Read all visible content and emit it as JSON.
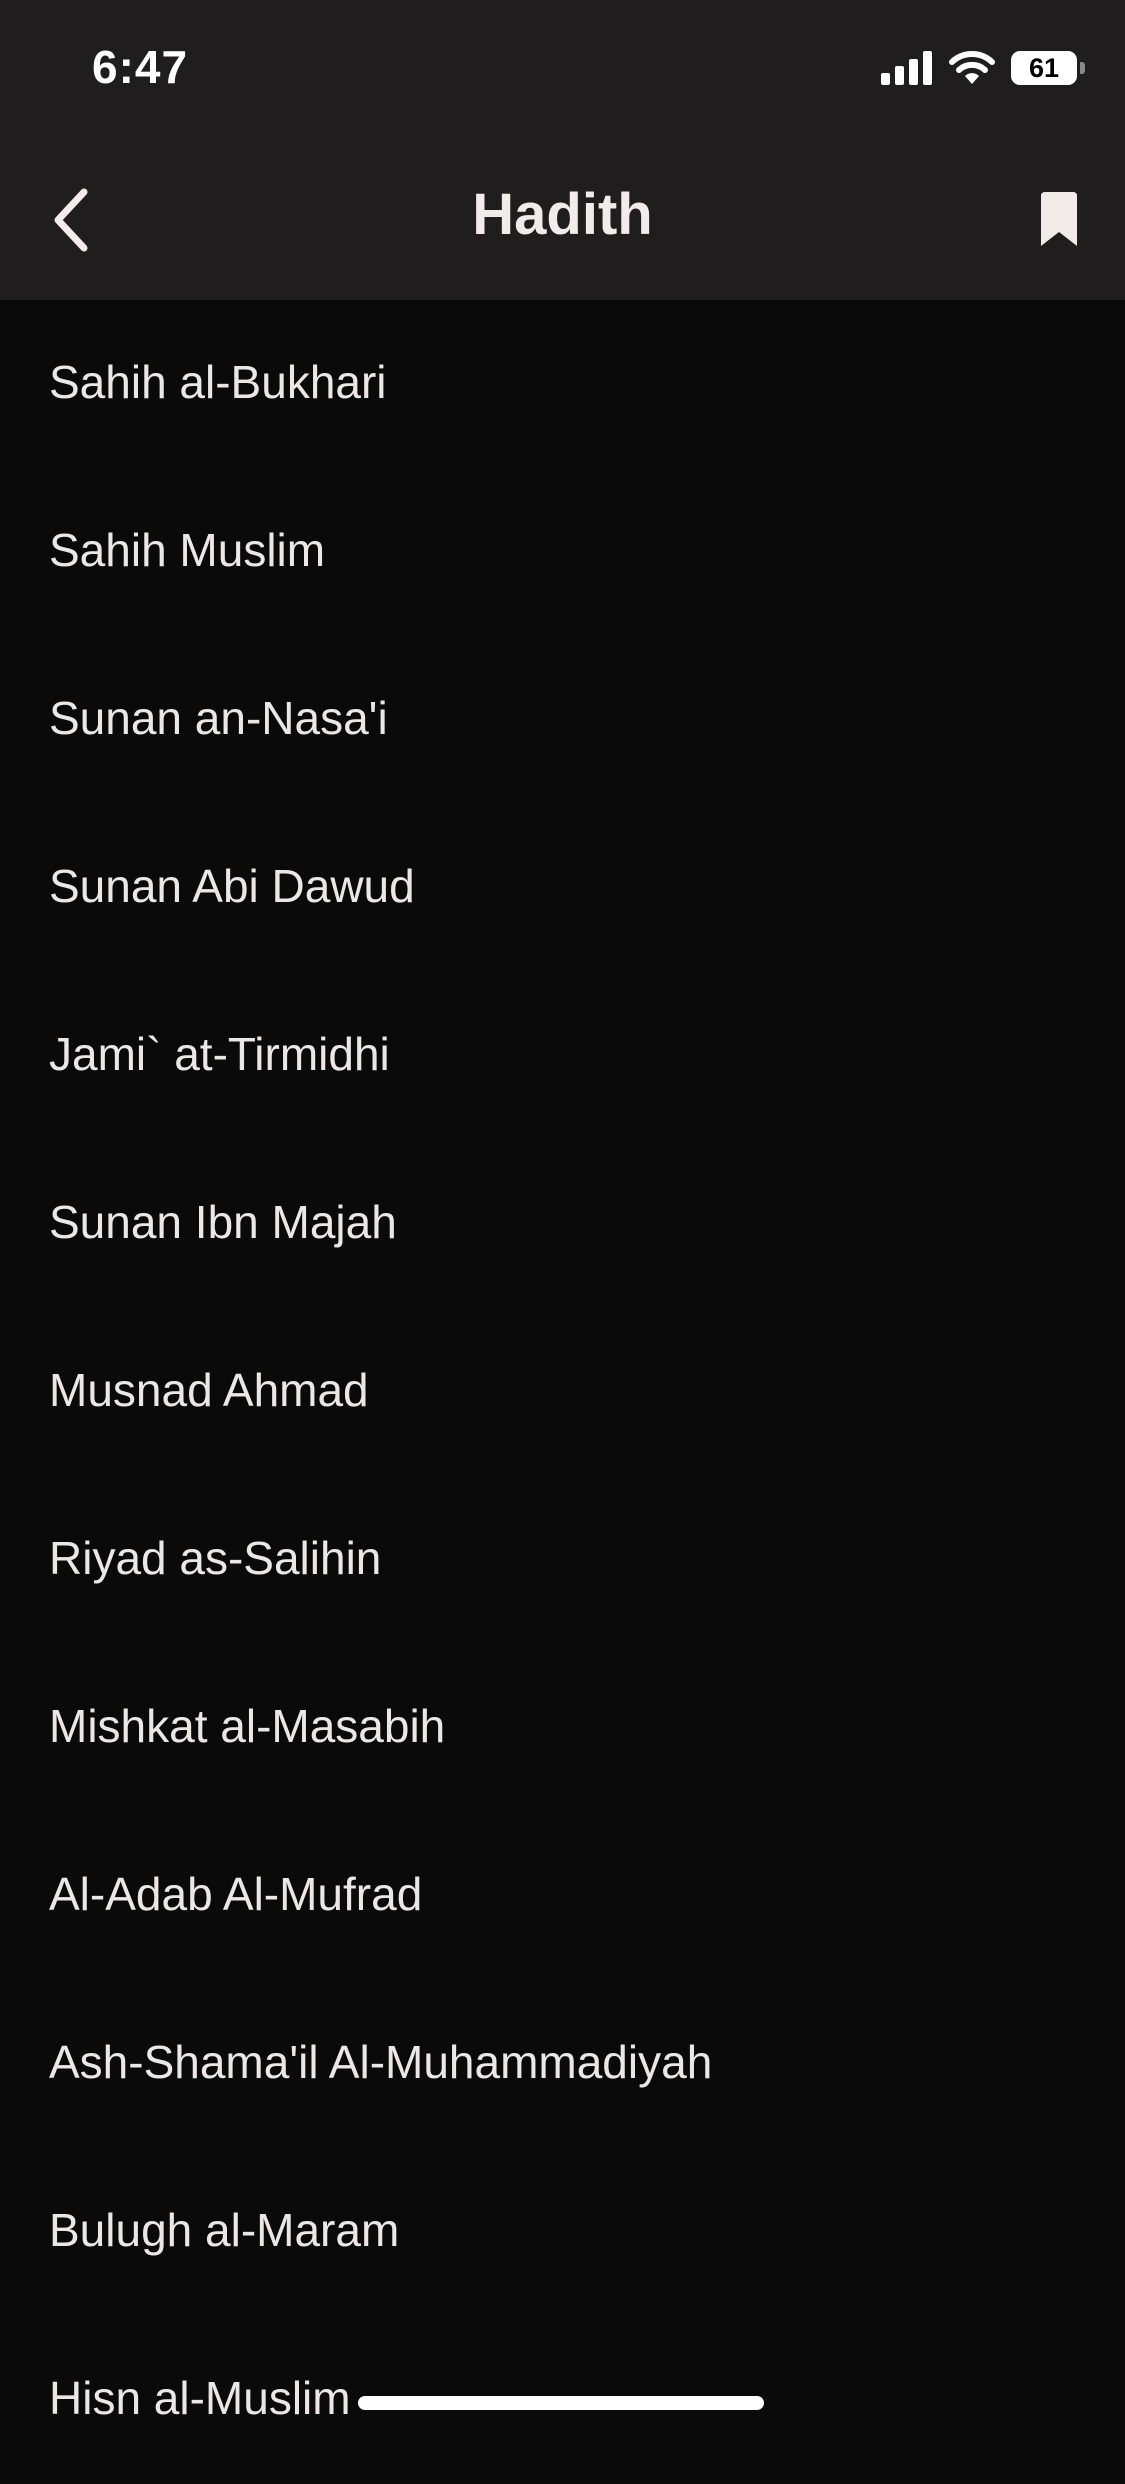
{
  "status_bar": {
    "time": "6:47",
    "battery_level": "61"
  },
  "nav": {
    "title": "Hadith",
    "back_icon": "chevron-left-icon",
    "bookmark_icon": "bookmark-icon"
  },
  "books": [
    {
      "label": "Sahih al-Bukhari"
    },
    {
      "label": "Sahih Muslim"
    },
    {
      "label": "Sunan an-Nasa'i"
    },
    {
      "label": "Sunan Abi Dawud"
    },
    {
      "label": "Jami` at-Tirmidhi"
    },
    {
      "label": "Sunan Ibn Majah"
    },
    {
      "label": "Musnad Ahmad"
    },
    {
      "label": "Riyad as-Salihin"
    },
    {
      "label": "Mishkat al-Masabih"
    },
    {
      "label": "Al-Adab Al-Mufrad"
    },
    {
      "label": "Ash-Shama'il Al-Muhammadiyah"
    },
    {
      "label": "Bulugh al-Maram"
    },
    {
      "label": "Hisn al-Muslim"
    }
  ],
  "colors": {
    "header_background": "#201d1e",
    "page_background": "#0a0a0a",
    "text": "#ece7e5"
  }
}
